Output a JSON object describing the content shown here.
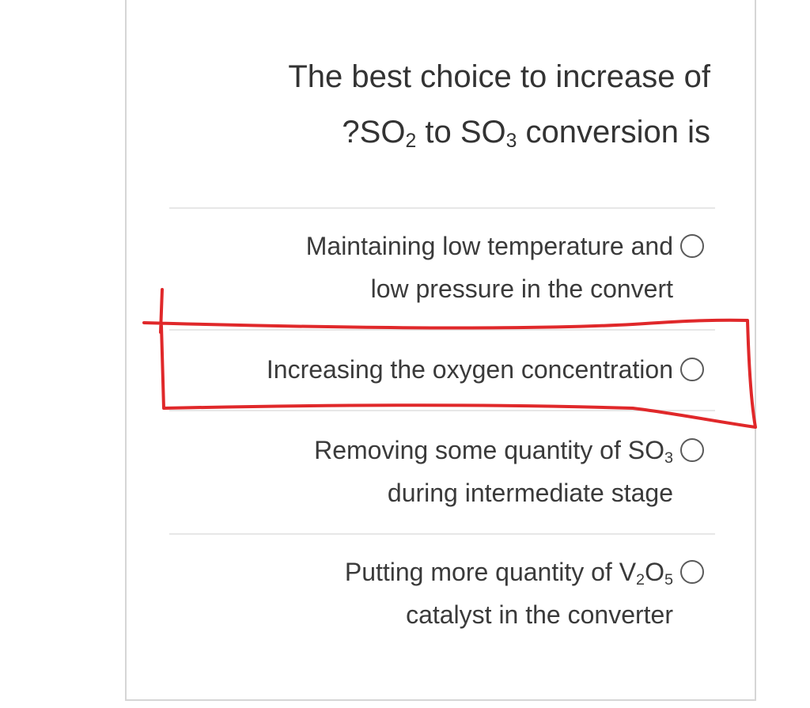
{
  "question": {
    "line1": "The best choice to increase of",
    "line2_prefix": "?SO",
    "line2_sub1": "2",
    "line2_mid": " to SO",
    "line2_sub2": "3",
    "line2_suffix": " conversion is"
  },
  "options": [
    {
      "line1": "Maintaining low temperature and",
      "line2": "low pressure in the convert",
      "selected": false
    },
    {
      "line1": "Increasing the oxygen concentration",
      "selected": false
    },
    {
      "line1_prefix": "Removing some quantity of SO",
      "line1_sub": "3",
      "line2": "during intermediate stage",
      "selected": false
    },
    {
      "line1_prefix": "Putting more quantity of V",
      "line1_sub1": "2",
      "line1_mid": "O",
      "line1_sub2": "5",
      "line2": "catalyst in the converter",
      "selected": false
    }
  ],
  "annotation_color": "#e0282a",
  "divider_color": "#e7e7e7",
  "radio_icon": "radio-unchecked-icon"
}
